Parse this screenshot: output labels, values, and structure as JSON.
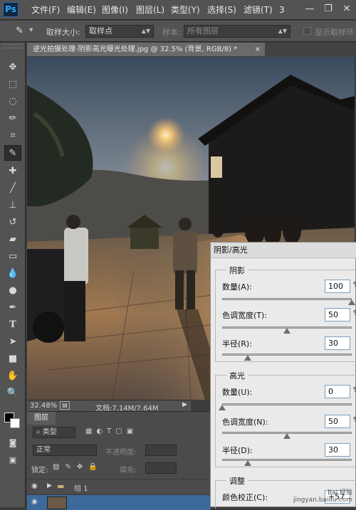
{
  "app": {
    "logo": "Ps"
  },
  "menu": [
    "文件(F)",
    "编辑(E)",
    "图像(I)",
    "图层(L)",
    "类型(Y)",
    "选择(S)",
    "滤镜(T)",
    "3"
  ],
  "options": {
    "sample_size_label": "取样大小:",
    "sample_size_value": "取样点",
    "sample_label": "样本:",
    "sample_value": "所有图层",
    "show_ring_label": "显示取样环"
  },
  "document": {
    "tab_title": "逆光拍摄处理-阴影高光曝光处理.jpg @ 32.5% (背景, RGB/8) *",
    "close_glyph": "×"
  },
  "status": {
    "zoom": "32.48%",
    "doc_info": "文档:7.14M/7.64M"
  },
  "layers": {
    "tab": "图层",
    "kind_label": "类型",
    "blend_mode": "正常",
    "opacity_label": "不透明度:",
    "lock_label": "锁定:",
    "fill_label": "填充:",
    "group_name": "组 1"
  },
  "dialog": {
    "title": "阴影/高光",
    "shadows": {
      "label": "阴影",
      "amount_label": "数量(A):",
      "amount_value": "100",
      "tonal_label": "色调宽度(T):",
      "tonal_value": "50",
      "radius_label": "半径(R):",
      "radius_value": "30"
    },
    "highlights": {
      "label": "高光",
      "amount_label": "数量(U):",
      "amount_value": "0",
      "tonal_label": "色调宽度(N):",
      "tonal_value": "50",
      "radius_label": "半径(D):",
      "radius_value": "30"
    },
    "adjust": {
      "label": "调整",
      "color_label": "颜色校正(C):",
      "color_value": "+57"
    },
    "sliders": {
      "shadow_amount": 1.0,
      "shadow_tonal": 0.5,
      "shadow_radius": 0.2,
      "highlight_amount": 0.0,
      "highlight_tonal": 0.5,
      "highlight_radius": 0.2
    }
  },
  "watermark": {
    "line1": "Bai 经验",
    "line2": "jingyan.baidu.com"
  }
}
